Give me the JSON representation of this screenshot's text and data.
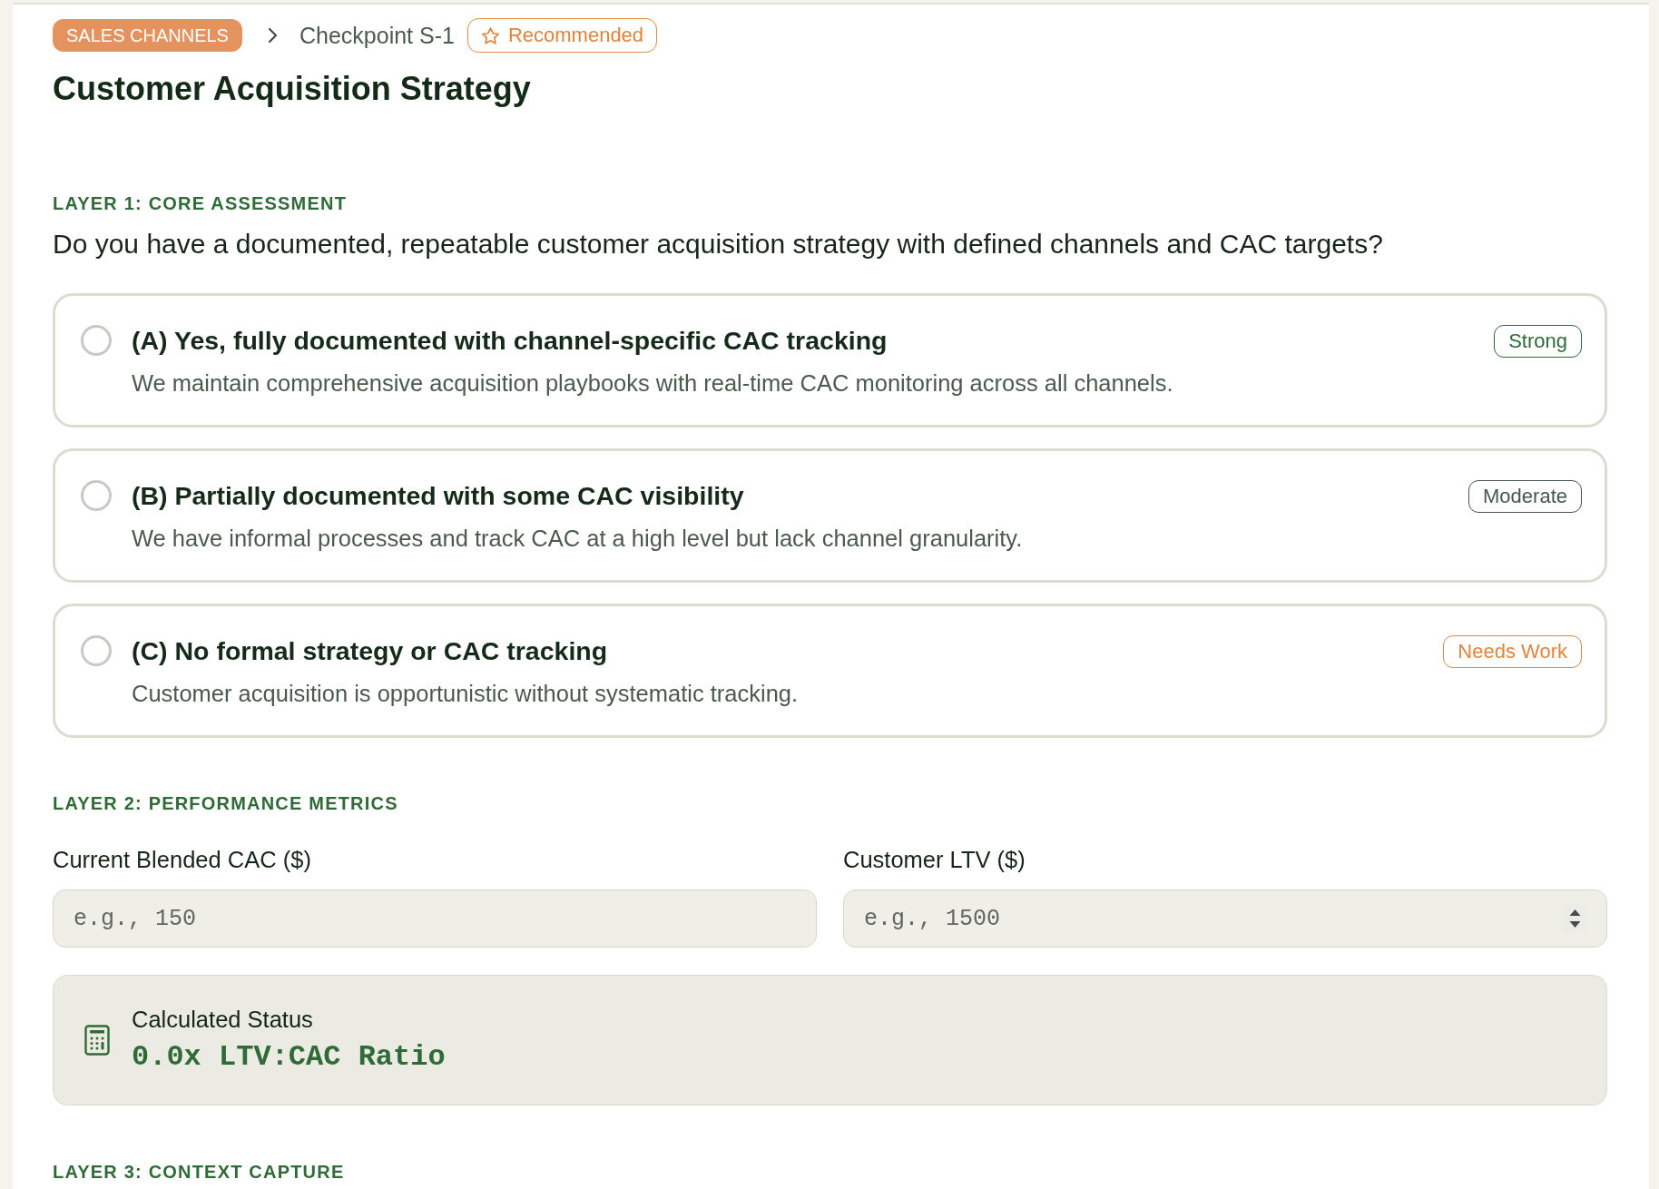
{
  "breadcrumb": {
    "category": "SALES CHANNELS",
    "checkpoint": "Checkpoint S-1",
    "badge": "Recommended"
  },
  "title": "Customer Acquisition Strategy",
  "layer_1": {
    "heading": "LAYER 1: CORE ASSESSMENT",
    "question": "Do you have a documented, repeatable customer acquisition strategy with defined channels and CAC targets?",
    "options": [
      {
        "title": "(A) Yes, fully documented with channel-specific CAC tracking",
        "description": "We maintain comprehensive acquisition playbooks with real-time CAC monitoring across all channels.",
        "rating": {
          "label": "Strong",
          "color": "#2d6a35"
        },
        "selected": false
      },
      {
        "title": "(B) Partially documented with some CAC visibility",
        "description": "We have informal processes and track CAC at a high level but lack channel granularity.",
        "rating": {
          "label": "Moderate",
          "color": "#45574a"
        },
        "selected": false
      },
      {
        "title": "(C) No formal strategy or CAC tracking",
        "description": "Customer acquisition is opportunistic without systematic tracking.",
        "rating": {
          "label": "Needs Work",
          "color": "#e2853d"
        },
        "selected": false
      }
    ]
  },
  "layer_2": {
    "heading": "LAYER 2: PERFORMANCE METRICS",
    "fields": [
      {
        "kind": "text",
        "label": "Current Blended CAC ($)",
        "placeholder": "e.g., 150"
      },
      {
        "kind": "number",
        "label": "Customer LTV ($)",
        "placeholder": "e.g., 1500"
      }
    ],
    "calculated_status": {
      "label": "Calculated Status",
      "value": "0.0x LTV:CAC Ratio"
    }
  },
  "layer_3": {
    "heading": "LAYER 3: CONTEXT CAPTURE"
  }
}
